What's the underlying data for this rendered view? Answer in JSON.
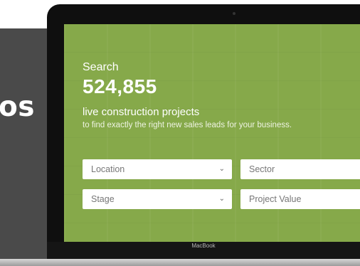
{
  "banner": {
    "text": "os"
  },
  "hero": {
    "search_label": "Search",
    "project_count": "524,855",
    "headline": "live construction projects",
    "subline": "to find exactly the right new sales leads for your business."
  },
  "filters": {
    "location": "Location",
    "sector": "Sector",
    "stage": "Stage",
    "project_value": "Project Value",
    "chevron": "⌄"
  },
  "device": {
    "brand": "MacBook"
  },
  "colors": {
    "hero_background": "#86a94a",
    "banner_background": "#4a4a4a",
    "bezel": "#0f0f0f"
  }
}
